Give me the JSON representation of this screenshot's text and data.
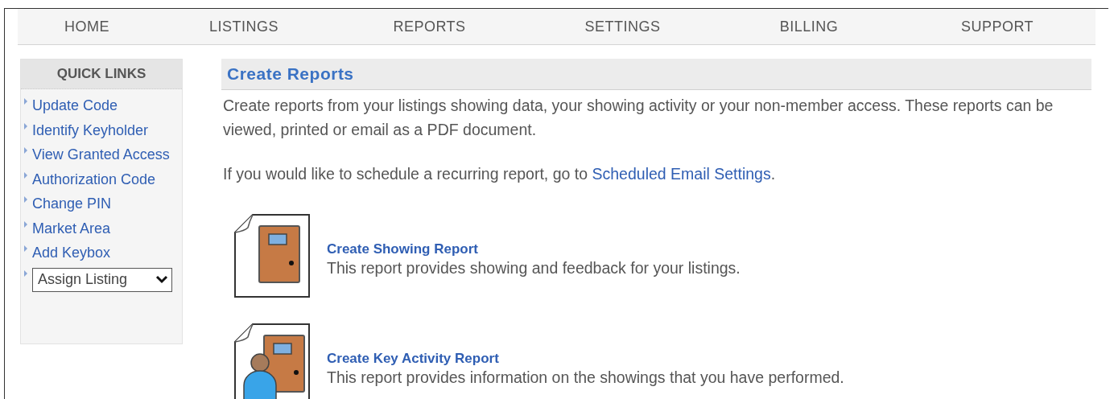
{
  "nav": [
    {
      "label": "HOME"
    },
    {
      "label": "LISTINGS"
    },
    {
      "label": "REPORTS"
    },
    {
      "label": "SETTINGS"
    },
    {
      "label": "BILLING"
    },
    {
      "label": "SUPPORT"
    }
  ],
  "sidebar": {
    "title": "QUICK LINKS",
    "items": [
      {
        "kind": "link",
        "label": "Update Code"
      },
      {
        "kind": "link",
        "label": "Identify Keyholder"
      },
      {
        "kind": "link",
        "label": "View Granted Access"
      },
      {
        "kind": "link",
        "label": "Authorization Code"
      },
      {
        "kind": "link",
        "label": "Change PIN"
      },
      {
        "kind": "link",
        "label": "Market Area"
      },
      {
        "kind": "link",
        "label": "Add Keybox"
      },
      {
        "kind": "select",
        "label": "Assign Listing"
      }
    ]
  },
  "main": {
    "title": "Create Reports",
    "intro": "Create reports from your listings showing data, your showing activity or your non-member access. These reports can be viewed, printed or email as a PDF document.",
    "schedule": {
      "text": "If you would like to schedule a recurring report, go to ",
      "link": "Scheduled Email Settings",
      "suffix": "."
    },
    "reports": [
      {
        "kind": "door",
        "title": "Create Showing Report",
        "description": "This report provides showing and feedback for your listings."
      },
      {
        "kind": "person",
        "title": "Create Key Activity Report",
        "description": "This report provides information on the showings that you have performed."
      }
    ]
  }
}
